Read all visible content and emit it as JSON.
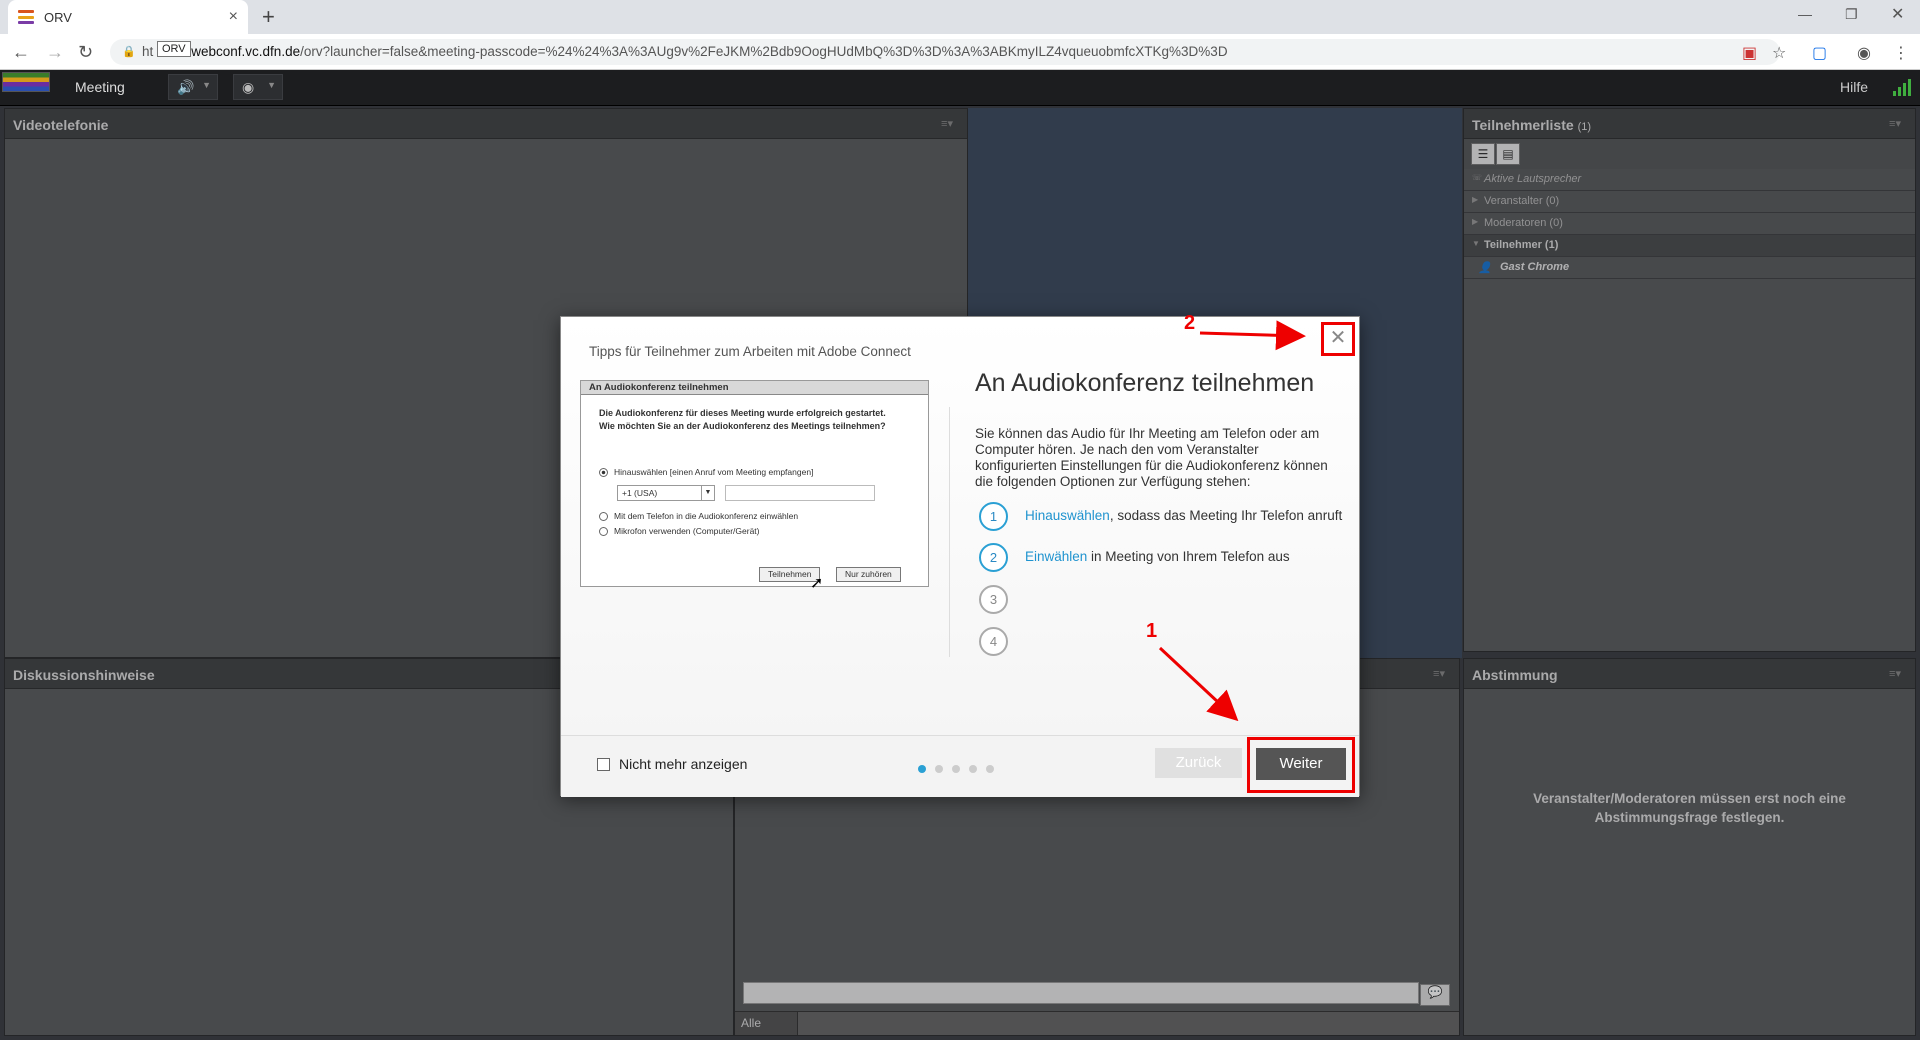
{
  "browser": {
    "tab_title": "ORV",
    "tooltip": "ORV",
    "url_prefix": "ht",
    "url_host": "webconf.vc.dfn.de",
    "url_rest": "/orv?launcher=false&meeting-passcode=%24%24%3A%3AUg9v%2FeJKM%2Bdb9OogHUdMbQ%3D%3D%3A%3ABKmyILZ4vqueuobmfcXTKg%3D%3D"
  },
  "appbar": {
    "meeting_menu": "Meeting",
    "help": "Hilfe"
  },
  "pods": {
    "video": {
      "title": "Videotelefonie"
    },
    "discussion": {
      "title": "Diskussionshinweise"
    },
    "chat": {
      "filter_label": "Alle"
    },
    "participants": {
      "title": "Teilnehmerliste",
      "count": "(1)",
      "rows": {
        "speakers": "Aktive Lautsprecher",
        "hosts": "Veranstalter (0)",
        "presenters": "Moderatoren (0)",
        "participants": "Teilnehmer (1)",
        "guest": "Gast Chrome"
      }
    },
    "poll": {
      "title": "Abstimmung",
      "message": "Veranstalter/Moderatoren müssen erst noch eine Abstimmungsfrage festlegen."
    }
  },
  "modal": {
    "tips_title": "Tipps für Teilnehmer zum Arbeiten mit Adobe Connect",
    "heading": "An Audiokonferenz teilnehmen",
    "description": "Sie können das Audio für Ihr Meeting am Telefon oder am Computer hören. Je nach den vom Veranstalter konfigurierten Einstellungen für die Audiokonferenz können die folgenden Optionen zur Verfügung stehen:",
    "steps": [
      {
        "num": "1",
        "link": "Hinauswählen",
        "text": ", sodass das Meeting Ihr Telefon anruft"
      },
      {
        "num": "2",
        "link": "Einwählen",
        "text": " in Meeting von Ihrem Telefon aus"
      },
      {
        "num": "3",
        "link": "",
        "text": ""
      },
      {
        "num": "4",
        "link": "",
        "text": ""
      }
    ],
    "dont_show": "Nicht mehr anzeigen",
    "back": "Zurück",
    "next": "Weiter",
    "page_current": 1,
    "page_total": 5,
    "screenshot": {
      "title": "An Audiokonferenz teilnehmen",
      "question": "Die Audiokonferenz für dieses Meeting wurde erfolgreich gestartet. Wie möchten Sie an der Audiokonferenz des Meetings teilnehmen?",
      "option1": "Hinauswählen [einen Anruf vom Meeting empfangen]",
      "country": "+1 (USA)",
      "option2": "Mit dem Telefon in die Audiokonferenz einwählen",
      "option3": "Mikrofon verwenden (Computer/Gerät)",
      "join": "Teilnehmen",
      "listen": "Nur zuhören"
    }
  },
  "annotations": {
    "label1": "1",
    "label2": "2",
    "color": "#e00000"
  }
}
